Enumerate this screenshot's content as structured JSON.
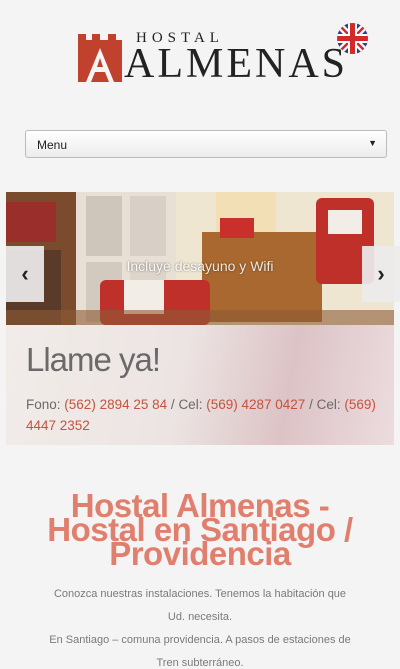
{
  "header": {
    "logo_small": "HOSTAL",
    "logo_large": "ALMENAS",
    "language_flag": "uk-flag-icon",
    "brand_color": "#c0422e"
  },
  "nav": {
    "menu_label": "Menu"
  },
  "slider": {
    "caption": "Incluye desayuno y Wifi",
    "prev_icon": "chevron-left-icon",
    "next_icon": "chevron-right-icon"
  },
  "contact": {
    "title": "Llame ya!",
    "fono_label": "Fono:",
    "fono_number": "(562) 2894 25 84",
    "separator": "/",
    "cel1_label": "Cel:",
    "cel1_number": "(569) 4287 0427",
    "cel2_label": "Cel:",
    "cel2_number": "(569) 4447 2352"
  },
  "main": {
    "title_line1": "Hostal Almenas -",
    "title_line2": "Hostal en Santiago /",
    "title_line3": "Providencia",
    "text_line1": "Conozca nuestras instalaciones. Tenemos la habitación que",
    "text_line2": "Ud. necesita.",
    "text_line3": "En Santiago – comuna providencia. A pasos de estaciones de",
    "text_line4": "Tren subterráneo.",
    "title_color": "#e07f6d"
  }
}
